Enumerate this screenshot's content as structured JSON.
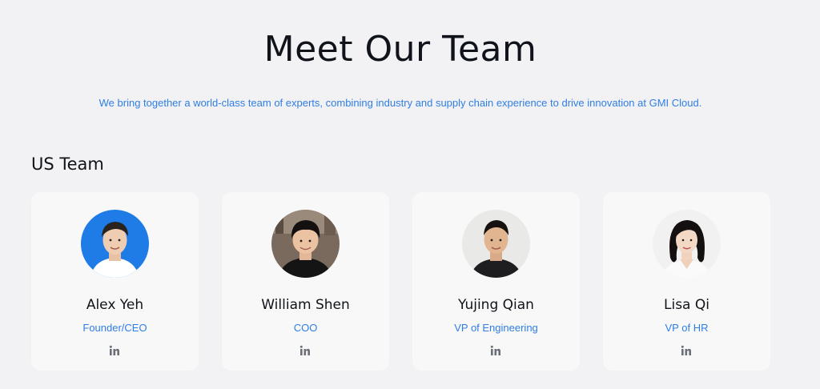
{
  "header": {
    "title": "Meet Our Team",
    "subtitle": "We bring together a world-class team of experts, combining industry and supply chain experience to drive innovation at GMI Cloud."
  },
  "section": {
    "title": "US Team"
  },
  "members": [
    {
      "name": "Alex Yeh",
      "role": "Founder/CEO",
      "icon": "linkedin-icon"
    },
    {
      "name": "William Shen",
      "role": "COO",
      "icon": "linkedin-icon"
    },
    {
      "name": "Yujing Qian",
      "role": "VP of Engineering",
      "icon": "linkedin-icon"
    },
    {
      "name": "Lisa Qi",
      "role": "VP of HR",
      "icon": "linkedin-icon"
    }
  ],
  "colors": {
    "accent": "#2f7ee6",
    "background": "#f2f2f4",
    "card": "#f8f8f8",
    "text": "#10131a"
  }
}
